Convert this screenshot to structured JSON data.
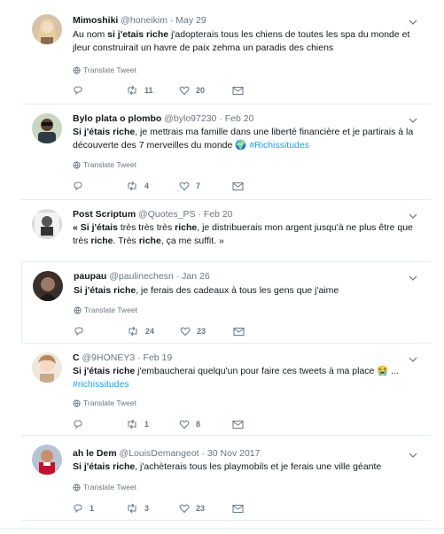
{
  "tweets": [
    {
      "name": "Mimoshiki",
      "handle": "@honeikim",
      "date": "May 29",
      "text": [
        {
          "t": "Au nom ",
          "b": false
        },
        {
          "t": "si j'etais riche",
          "b": true
        },
        {
          "t": "  j'adopterais tous les chiens de toutes les spa du monde et jleur construirait un havre de paix zehma un paradis des chiens",
          "b": false
        }
      ],
      "translate": "Translate Tweet",
      "reply_count": "",
      "retweet_count": "11",
      "like_count": "20"
    },
    {
      "name": "Bylo plata o plombo",
      "handle": "@bylo97230",
      "date": "Feb 20",
      "text": [
        {
          "t": "Si j'étais riche",
          "b": true
        },
        {
          "t": ", je mettrais ma famille dans une liberté financière et je partirais à la découverte des 7 merveilles du monde ",
          "b": false
        },
        {
          "t": "🌍",
          "b": false
        },
        {
          "t": " #Richissitudes",
          "b": false,
          "tag": true
        }
      ],
      "translate": "Translate Tweet",
      "reply_count": "",
      "retweet_count": "4",
      "like_count": "7"
    },
    {
      "name": "Post Scriptum",
      "handle": "@Quotes_PS",
      "date": "Feb 20",
      "text": [
        {
          "t": "« Si j'étais ",
          "b": true
        },
        {
          "t": "très très très ",
          "b": false
        },
        {
          "t": "riche",
          "b": true
        },
        {
          "t": ", je distribuerais mon argent jusqu'à ne plus être que très ",
          "b": false
        },
        {
          "t": "riche",
          "b": true
        },
        {
          "t": ". Très ",
          "b": false
        },
        {
          "t": "riche",
          "b": true
        },
        {
          "t": ", ça me suffit. »",
          "b": false
        }
      ],
      "translate": "",
      "reply_count": "",
      "retweet_count": "",
      "like_count": ""
    },
    {
      "name": "paupau",
      "handle": "@paulinechesn",
      "date": "Jan 26",
      "text": [
        {
          "t": "Si j'étais riche",
          "b": true
        },
        {
          "t": ", je ferais des cadeaux à tous les gens que j'aime",
          "b": false
        }
      ],
      "translate": "Translate Tweet",
      "reply_count": "",
      "retweet_count": "24",
      "like_count": "23"
    },
    {
      "name": "C",
      "handle": "@9HONEY3",
      "date": "Feb 19",
      "text": [
        {
          "t": "Si j'étais riche",
          "b": true
        },
        {
          "t": " j'embaucherai quelqu'un pour faire ces tweets à ma place ",
          "b": false
        },
        {
          "t": "😭",
          "b": false
        },
        {
          "t": " ...",
          "b": false
        },
        {
          "t": "#richissitudes",
          "b": false,
          "tag": true
        }
      ],
      "translate": "Translate Tweet",
      "reply_count": "",
      "retweet_count": "1",
      "like_count": "8"
    },
    {
      "name": "ah le Dem",
      "handle": "@LouisDemangeot",
      "date": "30 Nov 2017",
      "text": [
        {
          "t": "Si j'étais riche",
          "b": true
        },
        {
          "t": ", j'achèterais tous les playmobils et je ferais une ville géante",
          "b": false
        }
      ],
      "translate": "Translate Tweet",
      "reply_count": "1",
      "retweet_count": "3",
      "like_count": "23"
    }
  ],
  "colors": {
    "link": "#1da1f2",
    "muted": "#657786",
    "divider": "#e6ecf0"
  },
  "icons": [
    "avatar",
    "chevron-down-icon",
    "globe-icon",
    "reply-icon",
    "retweet-icon",
    "like-icon",
    "message-icon"
  ]
}
